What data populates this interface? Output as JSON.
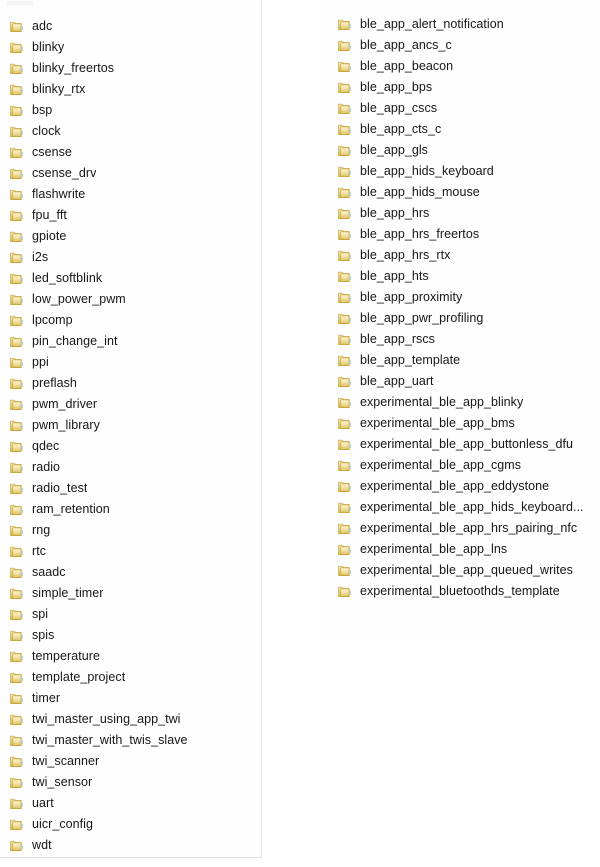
{
  "window": {
    "title": "Folder listing",
    "icon_name": "folder-icon",
    "accent_color": "#e3c86a",
    "text_color": "#16161a",
    "panel_background": "#fefefe",
    "page_background": "#ffffff"
  },
  "left_panel": {
    "name": "examples-peripheral-folder-list",
    "items": [
      {
        "label": "adc"
      },
      {
        "label": "blinky"
      },
      {
        "label": "blinky_freertos"
      },
      {
        "label": "blinky_rtx"
      },
      {
        "label": "bsp"
      },
      {
        "label": "clock"
      },
      {
        "label": "csense"
      },
      {
        "label": "csense_drv"
      },
      {
        "label": "flashwrite"
      },
      {
        "label": "fpu_fft"
      },
      {
        "label": "gpiote"
      },
      {
        "label": "i2s"
      },
      {
        "label": "led_softblink"
      },
      {
        "label": "low_power_pwm"
      },
      {
        "label": "lpcomp"
      },
      {
        "label": "pin_change_int"
      },
      {
        "label": "ppi"
      },
      {
        "label": "preflash"
      },
      {
        "label": "pwm_driver"
      },
      {
        "label": "pwm_library"
      },
      {
        "label": "qdec"
      },
      {
        "label": "radio"
      },
      {
        "label": "radio_test"
      },
      {
        "label": "ram_retention"
      },
      {
        "label": "rng"
      },
      {
        "label": "rtc"
      },
      {
        "label": "saadc"
      },
      {
        "label": "simple_timer"
      },
      {
        "label": "spi"
      },
      {
        "label": "spis"
      },
      {
        "label": "temperature"
      },
      {
        "label": "template_project"
      },
      {
        "label": "timer"
      },
      {
        "label": "twi_master_using_app_twi"
      },
      {
        "label": "twi_master_with_twis_slave"
      },
      {
        "label": "twi_scanner"
      },
      {
        "label": "twi_sensor"
      },
      {
        "label": "uart"
      },
      {
        "label": "uicr_config"
      },
      {
        "label": "wdt"
      }
    ]
  },
  "right_panel": {
    "name": "examples-ble-peripheral-folder-list",
    "items": [
      {
        "label": "ble_app_alert_notification"
      },
      {
        "label": "ble_app_ancs_c"
      },
      {
        "label": "ble_app_beacon"
      },
      {
        "label": "ble_app_bps"
      },
      {
        "label": "ble_app_cscs"
      },
      {
        "label": "ble_app_cts_c"
      },
      {
        "label": "ble_app_gls"
      },
      {
        "label": "ble_app_hids_keyboard"
      },
      {
        "label": "ble_app_hids_mouse"
      },
      {
        "label": "ble_app_hrs"
      },
      {
        "label": "ble_app_hrs_freertos"
      },
      {
        "label": "ble_app_hrs_rtx"
      },
      {
        "label": "ble_app_hts"
      },
      {
        "label": "ble_app_proximity"
      },
      {
        "label": "ble_app_pwr_profiling"
      },
      {
        "label": "ble_app_rscs"
      },
      {
        "label": "ble_app_template"
      },
      {
        "label": "ble_app_uart"
      },
      {
        "label": "experimental_ble_app_blinky"
      },
      {
        "label": "experimental_ble_app_bms"
      },
      {
        "label": "experimental_ble_app_buttonless_dfu"
      },
      {
        "label": "experimental_ble_app_cgms"
      },
      {
        "label": "experimental_ble_app_eddystone"
      },
      {
        "label": "experimental_ble_app_hids_keyboard..."
      },
      {
        "label": "experimental_ble_app_hrs_pairing_nfc"
      },
      {
        "label": "experimental_ble_app_lns"
      },
      {
        "label": "experimental_ble_app_queued_writes"
      },
      {
        "label": "experimental_bluetoothds_template"
      }
    ]
  }
}
